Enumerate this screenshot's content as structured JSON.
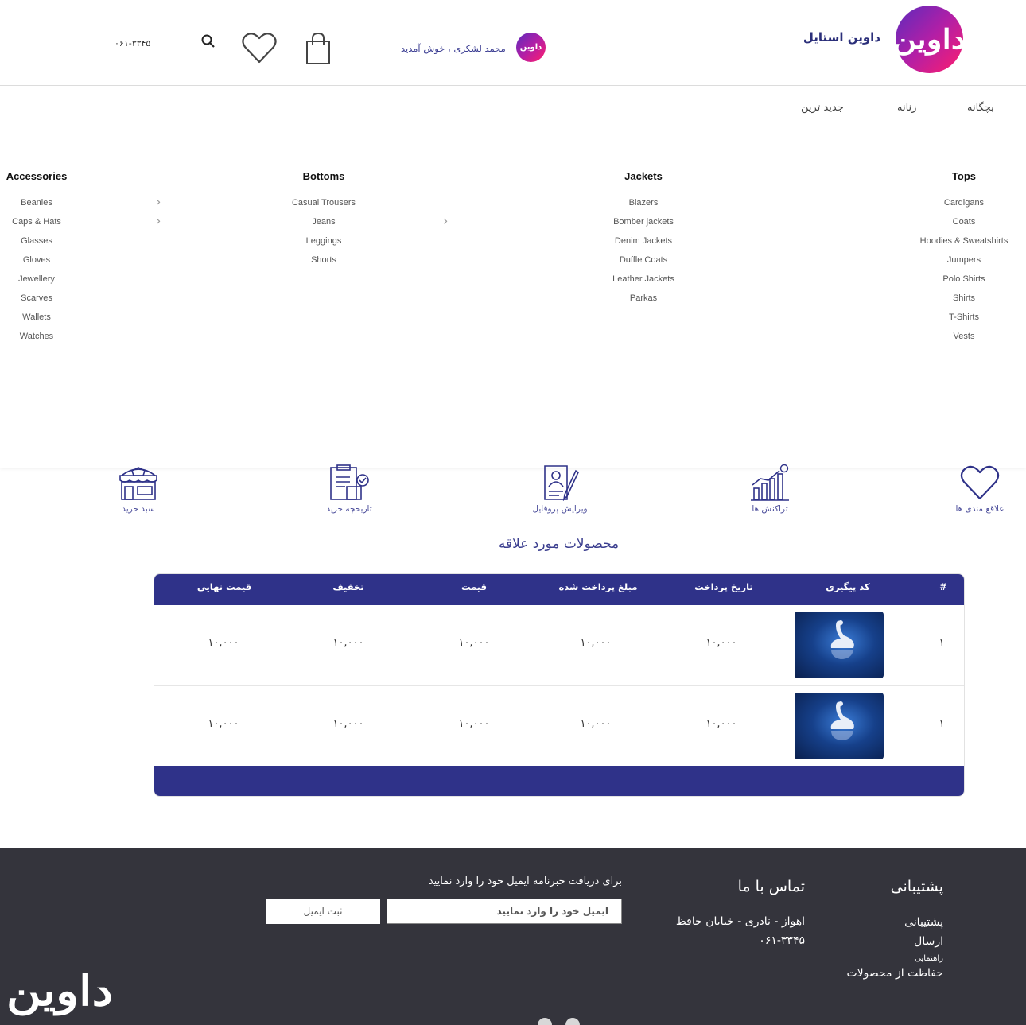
{
  "header": {
    "brand_name": "داوین استایل",
    "welcome_text": "محمد لشکری ، خوش آمدید",
    "phone": "۰۶۱-۳۳۴۵",
    "logo_glyph": "داوین",
    "avatar_glyph": "داوین"
  },
  "nav": {
    "items": [
      "بچگانه",
      "زنانه",
      "جدید ترین"
    ]
  },
  "mega_menu": {
    "tops": {
      "title": "Tops",
      "items": [
        "Cardigans",
        "Coats",
        "Hoodies & Sweatshirts",
        "Jumpers",
        "Polo Shirts",
        "Shirts",
        "T-Shirts",
        "Vests"
      ]
    },
    "jackets": {
      "title": "Jackets",
      "items": [
        "Blazers",
        "Bomber jackets",
        "Denim Jackets",
        "Duffle Coats",
        "Leather Jackets",
        "Parkas"
      ]
    },
    "bottoms": {
      "title": "Bottoms",
      "items": [
        "Casual Trousers",
        "Jeans",
        "Leggings",
        "Shorts"
      ]
    },
    "accessories": {
      "title": "Accessories",
      "items": [
        "Beanies",
        "Caps & Hats",
        "Glasses",
        "Gloves",
        "Jewellery",
        "Scarves",
        "Wallets",
        "Watches"
      ]
    }
  },
  "dashboard": {
    "items": [
      "علاقع مندی ها",
      "تراکنش ها",
      "ویرایش پروفایل",
      "تاریخچه خرید",
      "سبد خرید"
    ]
  },
  "section_title": "محصولات مورد علاقه",
  "table": {
    "headers": [
      "#",
      "کد پیگیری",
      "تاریخ پرداخت",
      "مبلغ پرداخت شده",
      "قیمت",
      "تخفیف",
      "قیمت نهایی"
    ],
    "rows": [
      {
        "index": "۱",
        "payment_date": "۱۰,۰۰۰",
        "paid_amount": "۱۰,۰۰۰",
        "price": "۱۰,۰۰۰",
        "discount": "۱۰,۰۰۰",
        "final_price": "۱۰,۰۰۰"
      },
      {
        "index": "۱",
        "payment_date": "۱۰,۰۰۰",
        "paid_amount": "۱۰,۰۰۰",
        "price": "۱۰,۰۰۰",
        "discount": "۱۰,۰۰۰",
        "final_price": "۱۰,۰۰۰"
      }
    ]
  },
  "footer": {
    "support_title": "پشتیبانی",
    "support_links": [
      "پشتیبانی",
      "ارسال",
      "راهنمایی",
      "حفاظت از محصولات"
    ],
    "contact_title": "تماس با ما",
    "address": "اهواز - نادری - خیابان حافظ",
    "phone": "۰۶۱-۳۳۴۵",
    "newsletter_text": "برای دریافت خبرنامه ایمیل خود را وارد نمایید",
    "newsletter_placeholder": "ایمیل خود را وارد نمایید",
    "newsletter_button": "ثبت ایمیل",
    "logo_glyph": "داوین"
  },
  "colors": {
    "primary": "#2f3289",
    "brand_gradient_start": "#5b2bbd",
    "brand_gradient_end": "#ff1e6d",
    "footer_bg": "#34343c"
  }
}
